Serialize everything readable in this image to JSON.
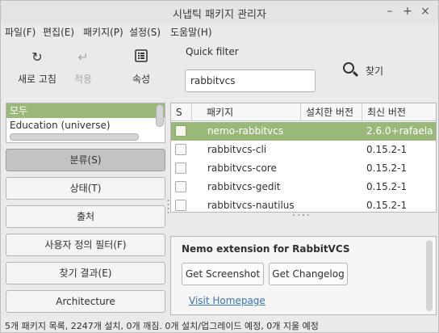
{
  "window": {
    "title": "시냅틱 패키지 관리자",
    "controls": {
      "minimize": "–",
      "maximize": "+",
      "close": "×"
    }
  },
  "menu": [
    "파일(F)",
    "편집(E)",
    "패키지(P)",
    "설정(S)",
    "도움말(H)"
  ],
  "toolbar": {
    "reload": {
      "label": "새로 고침",
      "icon": "reload-icon"
    },
    "apply": {
      "label": "적용",
      "icon": "apply-icon",
      "disabled": true
    },
    "properties": {
      "label": "속성",
      "icon": "properties-icon"
    },
    "quick_filter_label": "Quick filter",
    "quick_filter_value": "rabbitvcs",
    "search_label": "찾기"
  },
  "categories": [
    "모두",
    "Education (universe)"
  ],
  "sidebar_buttons": [
    "분류(S)",
    "상태(T)",
    "출처",
    "사용자 정의 필터(F)",
    "찾기 결과(E)",
    "Architecture"
  ],
  "table": {
    "columns": [
      "S",
      "패키지",
      "설치한 버전",
      "최신 버전"
    ],
    "rows": [
      {
        "name": "nemo-rabbitvcs",
        "installed": "",
        "latest": "2.6.0+rafaela",
        "selected": true
      },
      {
        "name": "rabbitvcs-cli",
        "installed": "",
        "latest": "0.15.2-1",
        "selected": false
      },
      {
        "name": "rabbitvcs-core",
        "installed": "",
        "latest": "0.15.2-1",
        "selected": false
      },
      {
        "name": "rabbitvcs-gedit",
        "installed": "",
        "latest": "0.15.2-1",
        "selected": false
      },
      {
        "name": "rabbitvcs-nautilus",
        "installed": "",
        "latest": "0.15.2-1",
        "selected": false
      }
    ]
  },
  "description": {
    "title": "Nemo extension for RabbitVCS",
    "screenshot_button": "Get Screenshot",
    "changelog_button": "Get Changelog",
    "homepage_link": "Visit Homepage"
  },
  "status": "5개 패키지 목록, 2247개 설치, 0개 깨짐. 0개 설치/업그레이드 예정, 0개 지울 예정",
  "colors": {
    "selection": "#9ab87a",
    "link": "#3b73b0"
  }
}
